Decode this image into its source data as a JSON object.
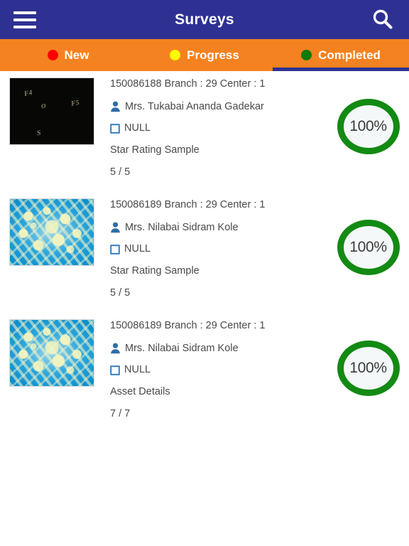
{
  "appbar": {
    "title": "Surveys",
    "menu_icon": "hamburger-menu-icon",
    "search_icon": "search-icon",
    "background_color": "#2e3192"
  },
  "tabs": {
    "background_color": "#f58220",
    "active_indicator_color": "#2e3192",
    "items": [
      {
        "label": "New",
        "dot_color": "#ff0000",
        "active": false
      },
      {
        "label": "Progress",
        "dot_color": "#ffff00",
        "active": false
      },
      {
        "label": "Completed",
        "dot_color": "#0a7a0a",
        "active": true
      }
    ]
  },
  "list": {
    "items": [
      {
        "thumbnail": "dark-keyboard-photo",
        "thumbnail_labels": [
          "F4",
          "F5",
          "O",
          "S"
        ],
        "title": "150086188 Branch : 29 Center : 1",
        "person_icon": "person-icon",
        "person_name": "Mrs. Tukabai Ananda Gadekar",
        "checkbox_icon": "checkbox-unchecked-icon",
        "checkbox_label": "NULL",
        "survey_name": "Star Rating Sample",
        "progress_fraction": "5 / 5",
        "percent": "100%",
        "percent_ring_color": "#138a13"
      },
      {
        "thumbnail": "cyan-rangoli-pattern",
        "thumbnail_labels": [],
        "title": "150086189 Branch : 29 Center : 1",
        "person_icon": "person-icon",
        "person_name": "Mrs. Nilabai Sidram Kole",
        "checkbox_icon": "checkbox-unchecked-icon",
        "checkbox_label": "NULL",
        "survey_name": "Star Rating Sample",
        "progress_fraction": "5 / 5",
        "percent": "100%",
        "percent_ring_color": "#138a13"
      },
      {
        "thumbnail": "cyan-rangoli-pattern",
        "thumbnail_labels": [],
        "title": "150086189 Branch : 29 Center : 1",
        "person_icon": "person-icon",
        "person_name": "Mrs. Nilabai Sidram Kole",
        "checkbox_icon": "checkbox-unchecked-icon",
        "checkbox_label": "NULL",
        "survey_name": "Asset Details",
        "progress_fraction": "7 / 7",
        "percent": "100%",
        "percent_ring_color": "#138a13"
      }
    ]
  }
}
